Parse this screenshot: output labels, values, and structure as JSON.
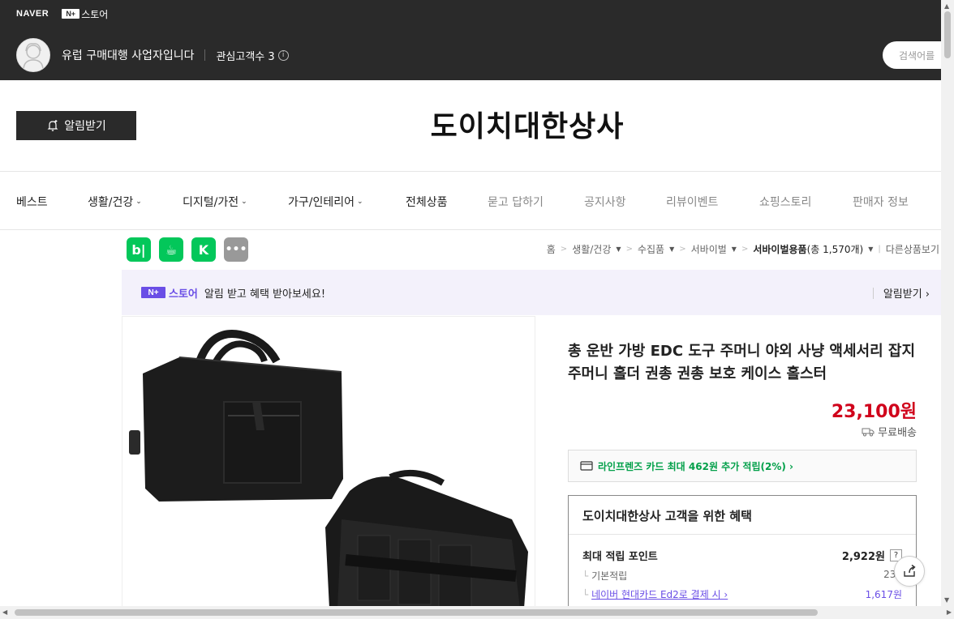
{
  "topbar": {
    "naver_logo": "NAVER",
    "nplus_badge": "N+",
    "store_label": "스토어",
    "seller_name": "유럽 구매대행 사업자입니다",
    "fans_label": "관심고객수 3",
    "info_icon": "ⓘ",
    "search_placeholder": "검색어를"
  },
  "header": {
    "alarm_button": "알림받기",
    "store_title": "도이치대한상사"
  },
  "nav": {
    "items": [
      {
        "label": "베스트"
      },
      {
        "label": "생활/건강"
      },
      {
        "label": "디지털/가전"
      },
      {
        "label": "가구/인테리어"
      },
      {
        "label": "전체상품"
      },
      {
        "label": "묻고 답하기"
      },
      {
        "label": "공지사항"
      },
      {
        "label": "리뷰이벤트"
      },
      {
        "label": "쇼핑스토리"
      },
      {
        "label": "판매자 정보"
      }
    ]
  },
  "share_icons": {
    "blog": "b|",
    "cafe": "☕",
    "band": "K",
    "more": "•••"
  },
  "breadcrumb": {
    "items": [
      "홈",
      "생활/건강",
      "수집품",
      "서바이벌"
    ],
    "current": "서바이벌용품",
    "count": "(총 1,570개)",
    "other": "다른상품보기"
  },
  "promo": {
    "nbadge": "N+",
    "store": "스토어",
    "text": "알림 받고 혜택 받아보세요!",
    "right": "알림받기 ›"
  },
  "product": {
    "title": "총 운반 가방 EDC 도구 주머니 야외 사냥 액세서리 잡지 주머니 홀더 권총 권총 보호 케이스 홀스터",
    "price": "23,100원",
    "delivery": "무료배송",
    "card_benefit": "라인프렌즈 카드 최대 462원 추가 적립(2%) ›"
  },
  "benefits": {
    "title": "도이치대한상사 고객을 위한 혜택",
    "max_points_label": "최대 적립 포인트",
    "max_points_value": "2,922원",
    "qmark": "?",
    "basic_label": "기본적립",
    "basic_value": "231",
    "card_link": "네이버 현대카드 Ed2로 결제 시 ›",
    "card_value": "1,617원"
  },
  "colors": {
    "dark": "#2a2a2a",
    "price_red": "#d0021b",
    "naver_green": "#03c75a",
    "store_purple": "#6a4ee6"
  }
}
